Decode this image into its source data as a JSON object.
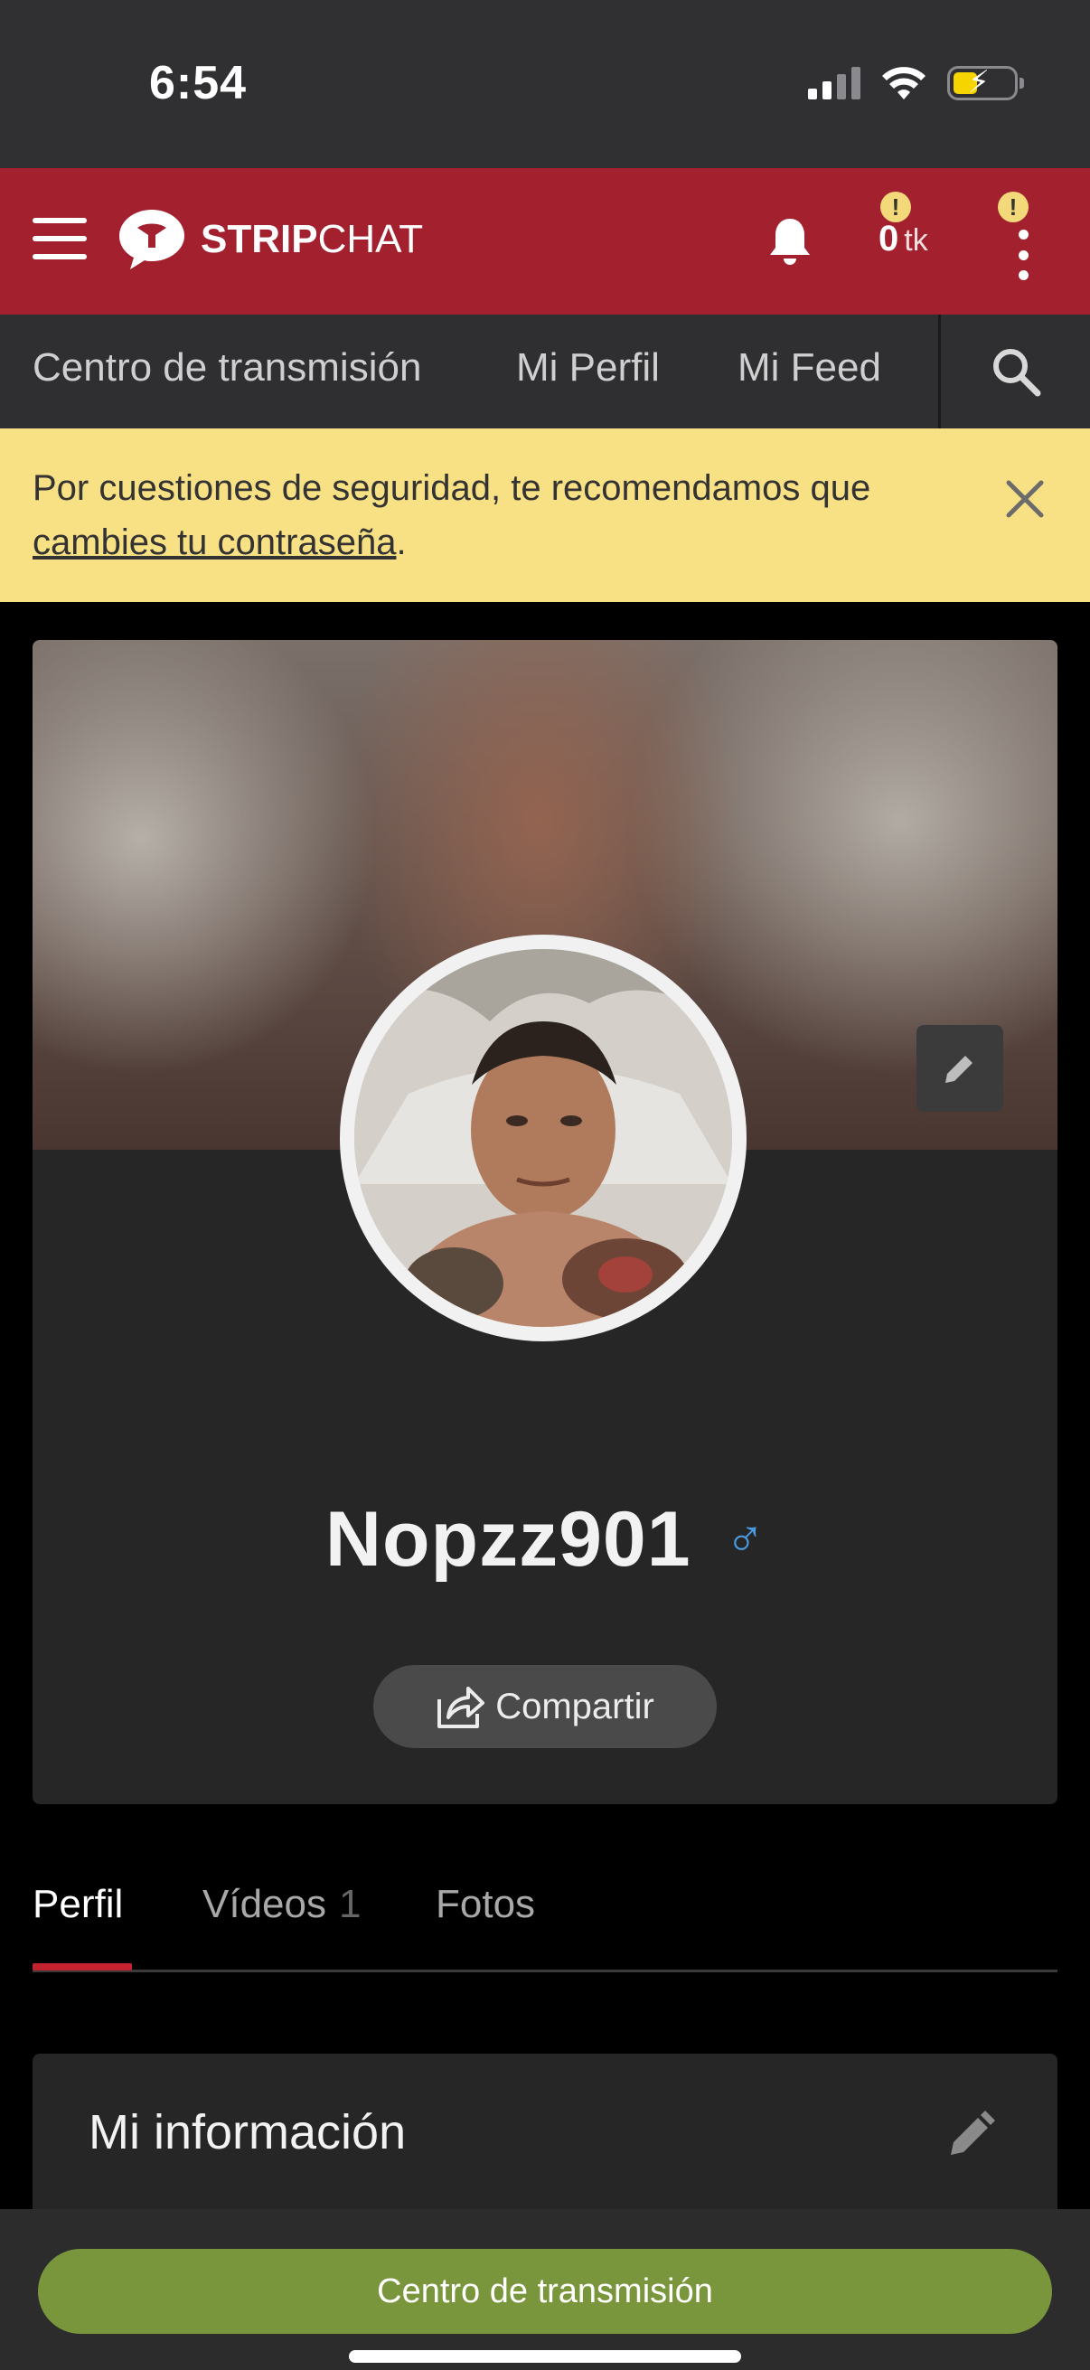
{
  "status_bar": {
    "time": "6:54"
  },
  "header": {
    "logo_bold": "STRIP",
    "logo_light": "CHAT",
    "tokens_value": "0",
    "tokens_unit": "tk",
    "warning_glyph": "!",
    "brand_color": "#a3212f"
  },
  "nav": {
    "items": [
      {
        "label": "Centro de transmisión"
      },
      {
        "label": "Mi Perfil"
      },
      {
        "label": "Mi Feed"
      }
    ]
  },
  "banner": {
    "text_before": "Por cuestiones de seguridad, te recomendamos que",
    "link_text": "cambies tu contraseña",
    "text_after": "."
  },
  "profile": {
    "username": "Nopzz901",
    "gender_symbol": "♂",
    "share_label": "Compartir"
  },
  "tabs": [
    {
      "label": "Perfil",
      "active": true
    },
    {
      "label": "Vídeos",
      "count": "1"
    },
    {
      "label": "Fotos"
    }
  ],
  "info": {
    "title": "Mi información"
  },
  "bottom_bar": {
    "broadcast_label": "Centro de transmisión",
    "button_color": "#7a963c"
  },
  "icons": [
    "menu-icon",
    "stripchat-logo-icon",
    "bell-icon",
    "warning-icon",
    "more-vertical-icon",
    "search-icon",
    "close-icon",
    "pencil-icon",
    "share-icon",
    "male-icon"
  ]
}
